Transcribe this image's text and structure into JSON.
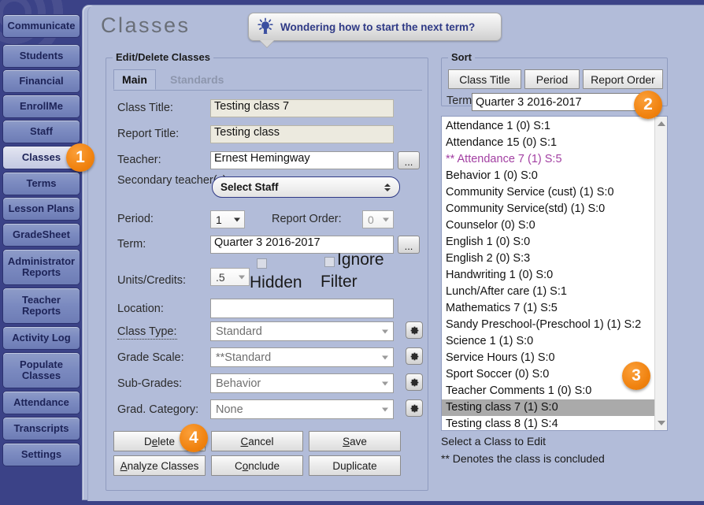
{
  "sidebar": {
    "items": [
      {
        "label": "Communicate",
        "active": false
      },
      {
        "label": "Students",
        "active": false
      },
      {
        "label": "Financial",
        "active": false
      },
      {
        "label": "EnrollMe",
        "active": false
      },
      {
        "label": "Staff",
        "active": false
      },
      {
        "label": "Classes",
        "active": true
      },
      {
        "label": "Terms",
        "active": false
      },
      {
        "label": "Lesson Plans",
        "active": false
      },
      {
        "label": "GradeSheet",
        "active": false
      },
      {
        "label": "Administrator Reports",
        "active": false
      },
      {
        "label": "Teacher Reports",
        "active": false
      },
      {
        "label": "Activity Log",
        "active": false
      },
      {
        "label": "Populate Classes",
        "active": false
      },
      {
        "label": "Attendance",
        "active": false
      },
      {
        "label": "Transcripts",
        "active": false
      },
      {
        "label": "Settings",
        "active": false
      }
    ]
  },
  "header": {
    "title": "Classes",
    "tip_text": "Wondering how to start the next term?",
    "tip_icon": "lightbulb-icon"
  },
  "edit_panel": {
    "legend": "Edit/Delete Classes",
    "tabs": [
      {
        "label": "Main",
        "state": "active"
      },
      {
        "label": "Standards",
        "state": "disabled"
      }
    ],
    "fields": {
      "class_title_label": "Class Title:",
      "class_title_value": "Testing class 7",
      "report_title_label": "Report Title:",
      "report_title_value": "Testing class",
      "teacher_label": "Teacher:",
      "teacher_value": "Ernest Hemingway",
      "teacher_browse_label": "...",
      "secondary_label": "Secondary teacher(s):",
      "secondary_value": "Select Staff",
      "period_label": "Period:",
      "period_value": "1",
      "report_order_label": "Report Order:",
      "report_order_value": "0",
      "term_label": "Term:",
      "term_value": "Quarter 3 2016-2017",
      "term_browse_label": "...",
      "units_label": "Units/Credits:",
      "units_value": ".5",
      "hidden_label": "Hidden",
      "ignore_filter_label": "Ignore Filter",
      "location_label": "Location:",
      "location_value": "",
      "class_type_label": "Class Type:",
      "class_type_value": "Standard",
      "grade_scale_label": "Grade Scale:",
      "grade_scale_value": "**Standard",
      "sub_grades_label": "Sub-Grades:",
      "sub_grades_value": "Behavior",
      "grad_category_label": "Grad. Category:",
      "grad_category_value": "None"
    },
    "buttons": [
      {
        "pre": "D",
        "accel": "e",
        "post": "lete"
      },
      {
        "pre": "",
        "accel": "C",
        "post": "ancel"
      },
      {
        "pre": "",
        "accel": "S",
        "post": "ave"
      },
      {
        "pre": "",
        "accel": "A",
        "post": "nalyze Classes"
      },
      {
        "pre": "C",
        "accel": "o",
        "post": "nclude"
      },
      {
        "pre": "Duplicate",
        "accel": "",
        "post": ""
      }
    ]
  },
  "sort_panel": {
    "legend": "Sort",
    "buttons": [
      "Class Title",
      "Period",
      "Report Order"
    ],
    "term_label": "Term:",
    "term_value": "Quarter 3 2016-2017"
  },
  "class_list": {
    "items": [
      {
        "label": "Attendance 1 (0) S:1",
        "concluded": false,
        "selected": false
      },
      {
        "label": "Attendance 15 (0) S:1",
        "concluded": false,
        "selected": false
      },
      {
        "label": "** Attendance 7 (1) S:5",
        "concluded": true,
        "selected": false
      },
      {
        "label": "Behavior 1 (0) S:0",
        "concluded": false,
        "selected": false
      },
      {
        "label": "Community Service (cust) (1) S:0",
        "concluded": false,
        "selected": false
      },
      {
        "label": "Community Service(std) (1) S:0",
        "concluded": false,
        "selected": false
      },
      {
        "label": "Counselor (0) S:0",
        "concluded": false,
        "selected": false
      },
      {
        "label": "English 1 (0) S:0",
        "concluded": false,
        "selected": false
      },
      {
        "label": "English 2 (0) S:3",
        "concluded": false,
        "selected": false
      },
      {
        "label": "Handwriting 1 (0) S:0",
        "concluded": false,
        "selected": false
      },
      {
        "label": "Lunch/After care (1) S:1",
        "concluded": false,
        "selected": false
      },
      {
        "label": "Mathematics 7 (1) S:5",
        "concluded": false,
        "selected": false
      },
      {
        "label": "Sandy Preschool-(Preschool 1) (1) S:2",
        "concluded": false,
        "selected": false
      },
      {
        "label": "Science 1 (1) S:0",
        "concluded": false,
        "selected": false
      },
      {
        "label": "Service Hours (1) S:0",
        "concluded": false,
        "selected": false
      },
      {
        "label": "Sport Soccer (0) S:0",
        "concluded": false,
        "selected": false
      },
      {
        "label": "Teacher Comments 1 (0) S:0",
        "concluded": false,
        "selected": false
      },
      {
        "label": "Testing class 7 (1) S:0",
        "concluded": false,
        "selected": true
      },
      {
        "label": "Testing class 8 (1) S:4",
        "concluded": false,
        "selected": false
      }
    ],
    "hint_line_1": "Select a Class to Edit",
    "hint_line_2": "** Denotes the class is concluded"
  },
  "badges": [
    {
      "number": "1"
    },
    {
      "number": "2"
    },
    {
      "number": "3"
    },
    {
      "number": "4"
    }
  ],
  "colors": {
    "rail_bg": "#3b4287",
    "panel_bg": "#b2bcd9",
    "accent_orange": "#f0820f",
    "concluded_purple": "#a23fa2",
    "selection_gray": "#aaaaaa"
  }
}
